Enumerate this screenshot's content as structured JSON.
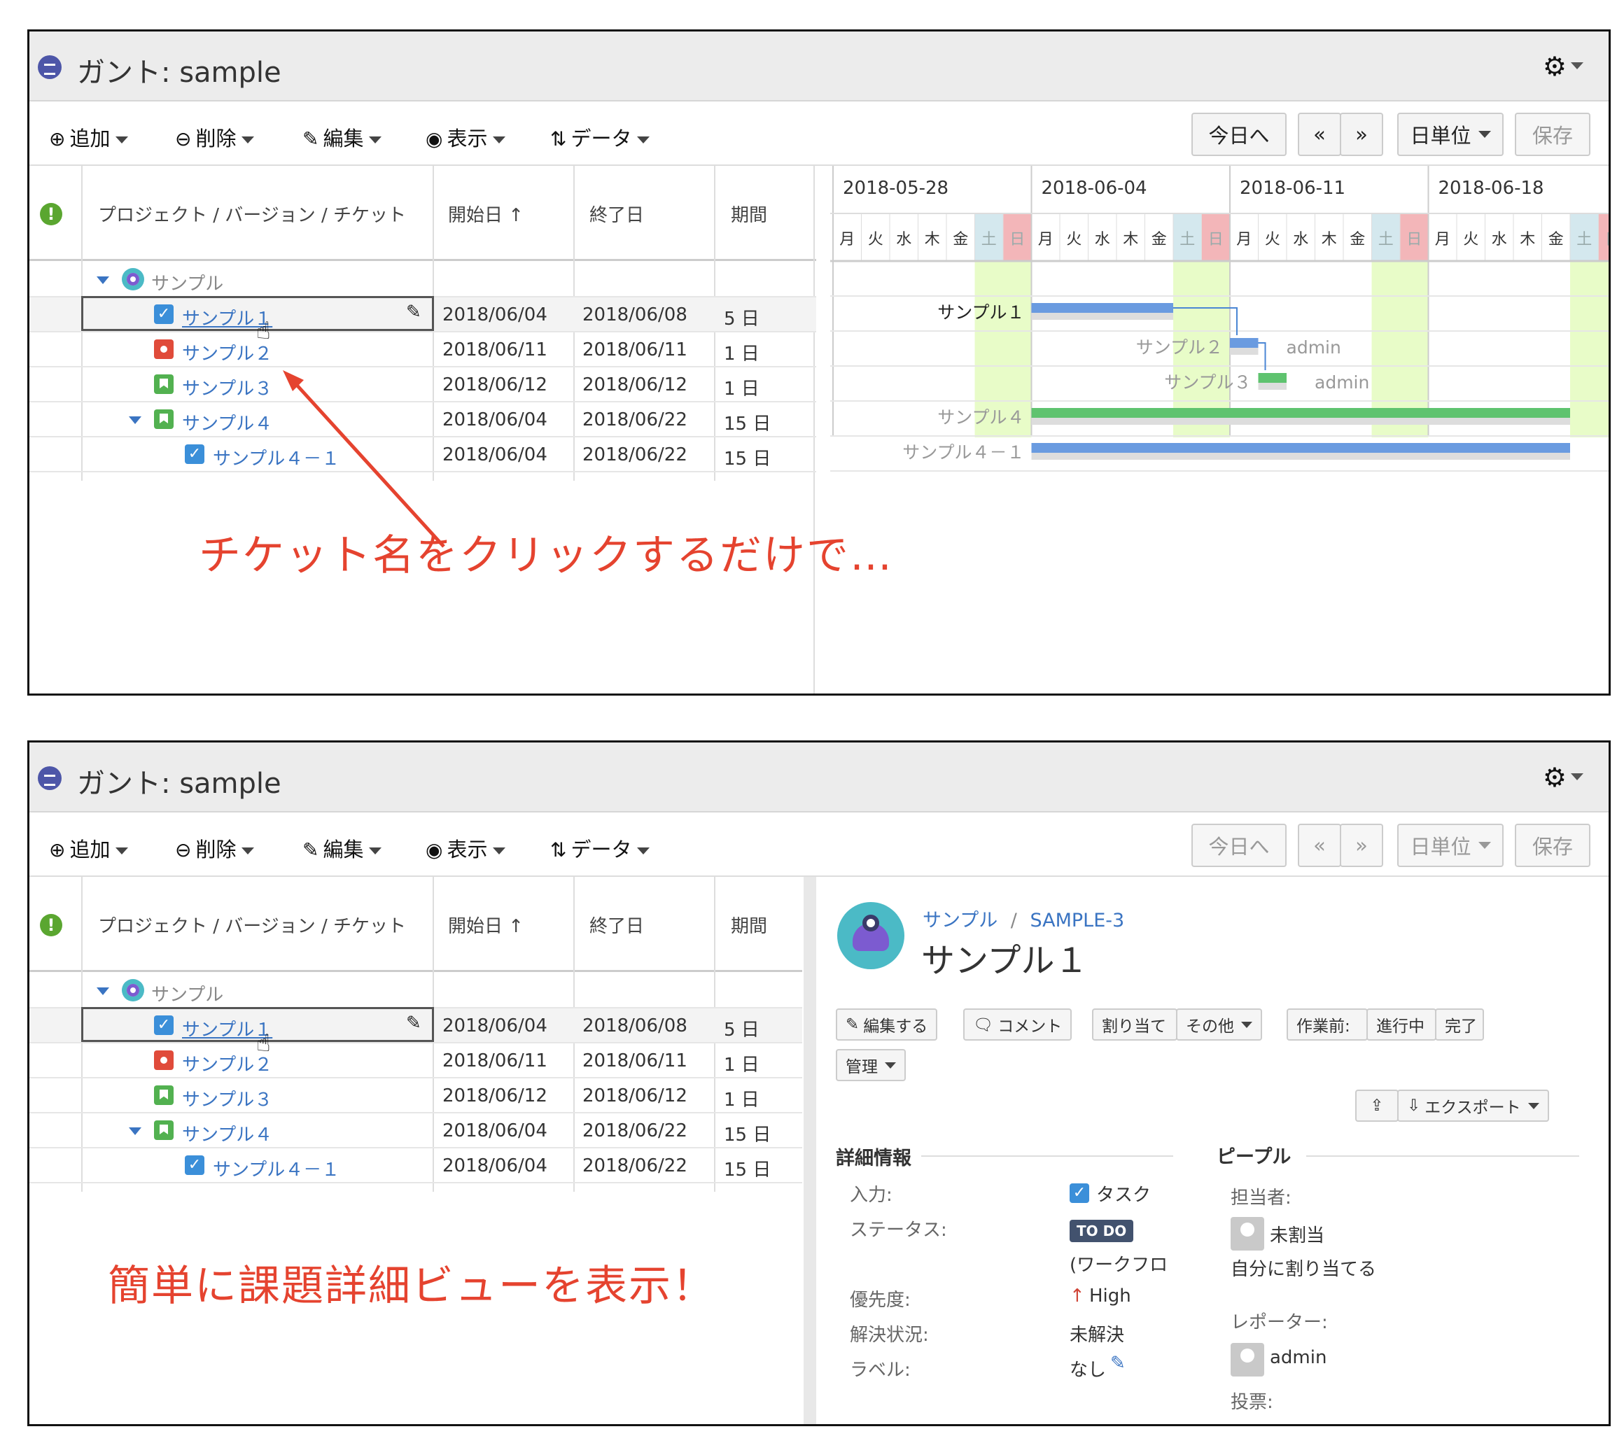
{
  "app": {
    "title": "ガント: sample"
  },
  "toolbar": {
    "add": "追加",
    "delete": "削除",
    "edit": "編集",
    "view": "表示",
    "data": "データ",
    "today": "今日へ",
    "prev": "«",
    "next": "»",
    "unit": "日単位",
    "save": "保存"
  },
  "grid": {
    "headers": {
      "name": "プロジェクト / バージョン / チケット",
      "start": "開始日",
      "end": "終了日",
      "duration": "期間"
    },
    "project": "サンプル",
    "rows": [
      {
        "name": "サンプル１",
        "start": "2018/06/04",
        "end": "2018/06/08",
        "duration": "5 日",
        "type": "task"
      },
      {
        "name": "サンプル２",
        "start": "2018/06/11",
        "end": "2018/06/11",
        "duration": "1 日",
        "type": "bug"
      },
      {
        "name": "サンプル３",
        "start": "2018/06/12",
        "end": "2018/06/12",
        "duration": "1 日",
        "type": "story"
      },
      {
        "name": "サンプル４",
        "start": "2018/06/04",
        "end": "2018/06/22",
        "duration": "15 日",
        "type": "story"
      },
      {
        "name": "サンプル４－１",
        "start": "2018/06/04",
        "end": "2018/06/22",
        "duration": "15 日",
        "type": "task"
      }
    ]
  },
  "gantt": {
    "weeks": [
      "2018-05-28",
      "2018-06-04",
      "2018-06-11",
      "2018-06-18"
    ],
    "weekdays": [
      "月",
      "火",
      "水",
      "木",
      "金",
      "土",
      "日"
    ],
    "bar_labels": [
      "サンプル１",
      "サンプル２",
      "サンプル３",
      "サンプル４",
      "サンプル４－１"
    ],
    "assignee_labels": [
      "admin",
      "admin"
    ],
    "colors": {
      "weekend": "#e8fcc8",
      "saturday_head": "#d4e8ee",
      "sunday_head": "#f3b6b9",
      "task_bar": "#6a9be0",
      "story_bar": "#5fc36f"
    }
  },
  "annotations": {
    "top": "チケット名をクリックするだけで…",
    "bottom": "簡単に課題詳細ビューを表示！",
    "color": "#e5432f"
  },
  "issue": {
    "breadcrumb_project": "サンプル",
    "breadcrumb_sep": "/",
    "key": "SAMPLE-3",
    "title": "サンプル１",
    "buttons": {
      "edit": "編集する",
      "comment": "コメント",
      "assign": "割り当て",
      "more": "その他",
      "todo": "作業前:",
      "in_progress": "進行中",
      "done": "完了",
      "admin": "管理",
      "export": "エクスポート"
    },
    "details_header": "詳細情報",
    "people_header": "ピープル",
    "fields": {
      "type_label": "入力:",
      "type_value": "タスク",
      "status_label": "ステータス:",
      "status_value": "TO DO",
      "workflow": "(ワークフロ",
      "priority_label": "優先度:",
      "priority_value": "High",
      "resolution_label": "解決状況:",
      "resolution_value": "未解決",
      "labels_label": "ラベル:",
      "labels_value": "なし"
    },
    "people": {
      "assignee_label": "担当者:",
      "assignee_value": "未割当",
      "assign_to_me": "自分に割り当てる",
      "reporter_label": "レポーター:",
      "reporter_value": "admin",
      "votes_label": "投票:"
    }
  }
}
